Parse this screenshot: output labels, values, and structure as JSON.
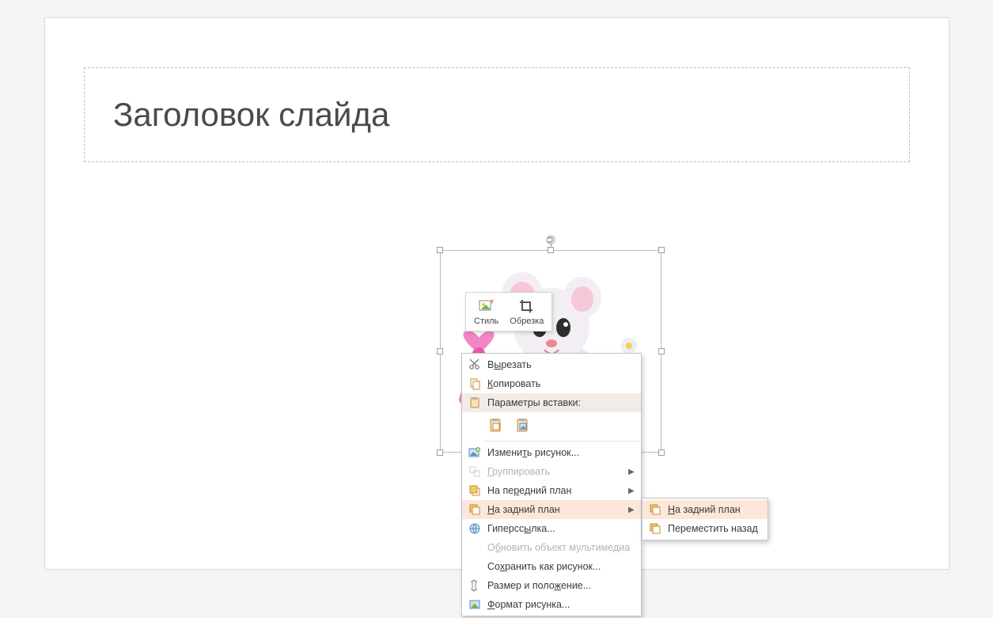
{
  "slide": {
    "title_placeholder": "Заголовок слайда"
  },
  "mini_toolbar": {
    "style_label": "Стиль",
    "crop_label": "Обрезка"
  },
  "context_menu": {
    "cut": "Вырезать",
    "copy": "Копировать",
    "paste_options_header": "Параметры вставки:",
    "change_picture": "Изменить рисунок...",
    "group": "Группировать",
    "bring_to_front": "На передний план",
    "send_to_back": "На задний план",
    "hyperlink": "Гиперссылка...",
    "update_media": "Обновить объект мультимедиа",
    "save_as_picture": "Сохранить как рисунок...",
    "size_position": "Размер и положение...",
    "format_picture": "Формат рисунка..."
  },
  "submenu": {
    "send_to_back": "На задний план",
    "send_backward": "Переместить назад"
  }
}
